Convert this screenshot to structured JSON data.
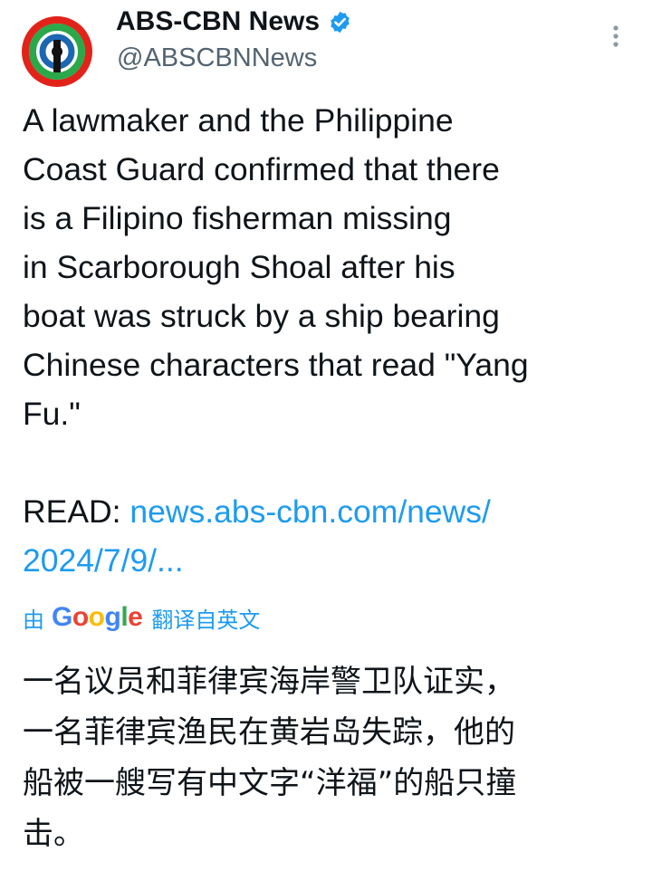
{
  "account": {
    "display_name": "ABS-CBN News",
    "handle": "@ABSCBNNews",
    "verified": true,
    "avatar_icon": "abs-cbn-logo-icon"
  },
  "tweet": {
    "text": "A lawmaker and the Philippine\nCoast Guard confirmed that there\nis a Filipino fisherman missing\nin Scarborough Shoal after his\nboat was struck by a ship bearing\nChinese characters that read \"Yang\nFu.\"",
    "read_label": "READ: ",
    "link_text": "news.abs-cbn.com/news/\n2024/7/9/..."
  },
  "translation": {
    "prefix": "由",
    "provider": "Google",
    "suffix": "翻译自英文",
    "text": "一名议员和菲律宾海岸警卫队证实，\n一名菲律宾渔民在黄岩岛失踪，他的\n船被一艘写有中文字“洋福”的船只撞\n击。"
  },
  "colors": {
    "link": "#1d9bf0",
    "text": "#0f1419",
    "secondary": "#536471",
    "verified_badge": "#1d9bf0"
  },
  "icons": {
    "more": "more-options-icon",
    "verified": "verified-badge-icon"
  }
}
